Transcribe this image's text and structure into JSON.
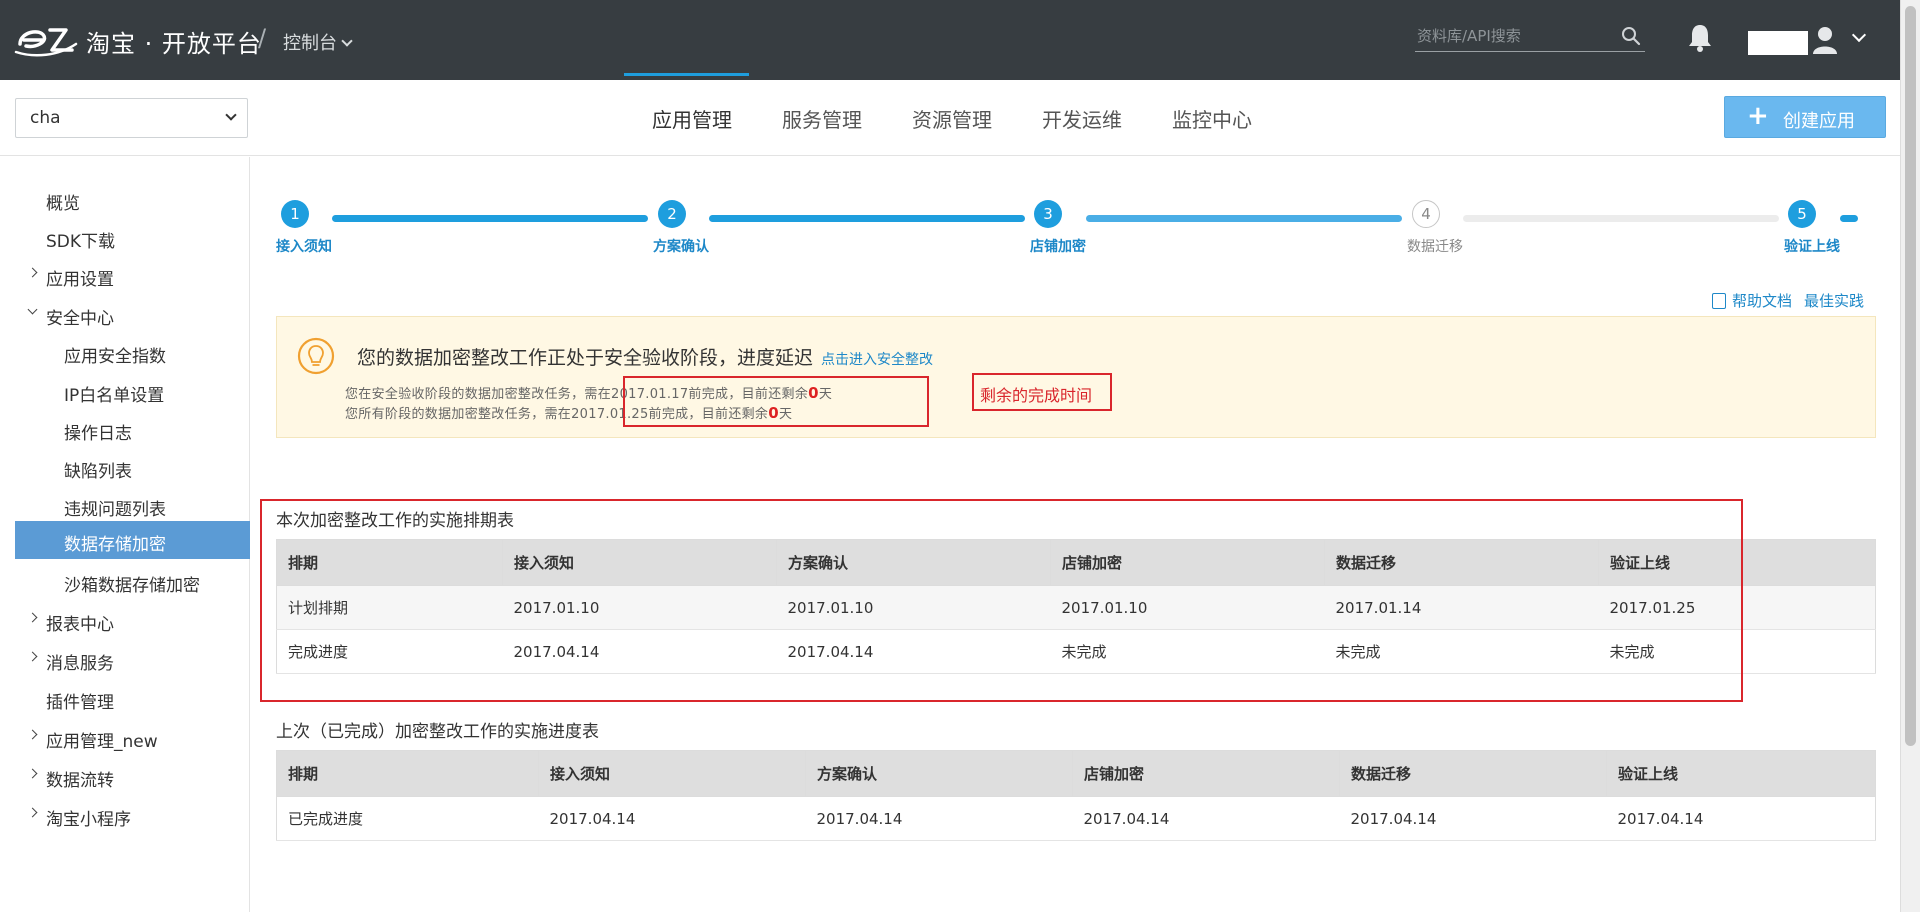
{
  "header": {
    "brand": "淘宝 · 开放平台",
    "slash": "/",
    "console_label": "控制台",
    "search_placeholder": "资料库/API搜索"
  },
  "navbar": {
    "app_select_value": "cha",
    "tabs": [
      {
        "label": "应用管理",
        "active": true
      },
      {
        "label": "服务管理"
      },
      {
        "label": "资源管理"
      },
      {
        "label": "开发运维"
      },
      {
        "label": "监控中心"
      }
    ],
    "create_button": "创建应用",
    "create_plus": "+"
  },
  "sidebar": {
    "items": [
      {
        "label": "概览"
      },
      {
        "label": "SDK下载"
      },
      {
        "label": "应用设置",
        "caret": "collapsed"
      },
      {
        "label": "安全中心",
        "caret": "expanded"
      },
      {
        "label": "应用安全指数"
      },
      {
        "label": "IP白名单设置"
      },
      {
        "label": "操作日志"
      },
      {
        "label": "缺陷列表"
      },
      {
        "label": "违规问题列表"
      },
      {
        "label": "数据存储加密",
        "active": true
      },
      {
        "label": "沙箱数据存储加密"
      },
      {
        "label": "报表中心",
        "caret": "collapsed"
      },
      {
        "label": "消息服务",
        "caret": "collapsed"
      },
      {
        "label": "插件管理"
      },
      {
        "label": "应用管理_new",
        "caret": "collapsed"
      },
      {
        "label": "数据流转",
        "caret": "collapsed"
      },
      {
        "label": "淘宝小程序",
        "caret": "collapsed"
      }
    ]
  },
  "steps": [
    {
      "num": "1",
      "label": "接入须知",
      "state": "done"
    },
    {
      "num": "2",
      "label": "方案确认",
      "state": "done"
    },
    {
      "num": "3",
      "label": "店铺加密",
      "state": "done"
    },
    {
      "num": "4",
      "label": "数据迁移",
      "state": "pending"
    },
    {
      "num": "5",
      "label": "验证上线",
      "state": "done"
    }
  ],
  "links": {
    "help_doc": "帮助文档",
    "best_practice": "最佳实践"
  },
  "notice": {
    "title": "您的数据加密整改工作正处于安全验收阶段，进度延迟",
    "link": "点击进入安全整改",
    "line1_prefix": "您在安全验收阶段的数据加密整改任务，需在2017.01.17前完成，目前还剩余",
    "line1_num": "0",
    "line1_suffix": "天",
    "line2_prefix": "您所有阶段的数据加密整改任务，需在2017.01.25前完成，目前还剩余",
    "line2_num": "0",
    "line2_suffix": "天",
    "annotation": "剩余的完成时间"
  },
  "schedule_table": {
    "title": "本次加密整改工作的实施排期表",
    "headers": [
      "排期",
      "接入须知",
      "方案确认",
      "店铺加密",
      "数据迁移",
      "验证上线"
    ],
    "rows": [
      [
        "计划排期",
        "2017.01.10",
        "2017.01.10",
        "2017.01.10",
        "2017.01.14",
        "2017.01.25"
      ],
      [
        "完成进度",
        "2017.04.14",
        "2017.04.14",
        "未完成",
        "未完成",
        "未完成"
      ]
    ]
  },
  "progress_table": {
    "title": "上次（已完成）加密整改工作的实施进度表",
    "headers": [
      "排期",
      "接入须知",
      "方案确认",
      "店铺加密",
      "数据迁移",
      "验证上线"
    ],
    "rows": [
      [
        "已完成进度",
        "2017.04.14",
        "2017.04.14",
        "2017.04.14",
        "2017.04.14",
        "2017.04.14"
      ]
    ]
  },
  "colors": {
    "topbar": "#373d41",
    "accent": "#1e9ede",
    "active_sidebar": "#5b9bd5",
    "annotation_red": "#d9262c"
  }
}
